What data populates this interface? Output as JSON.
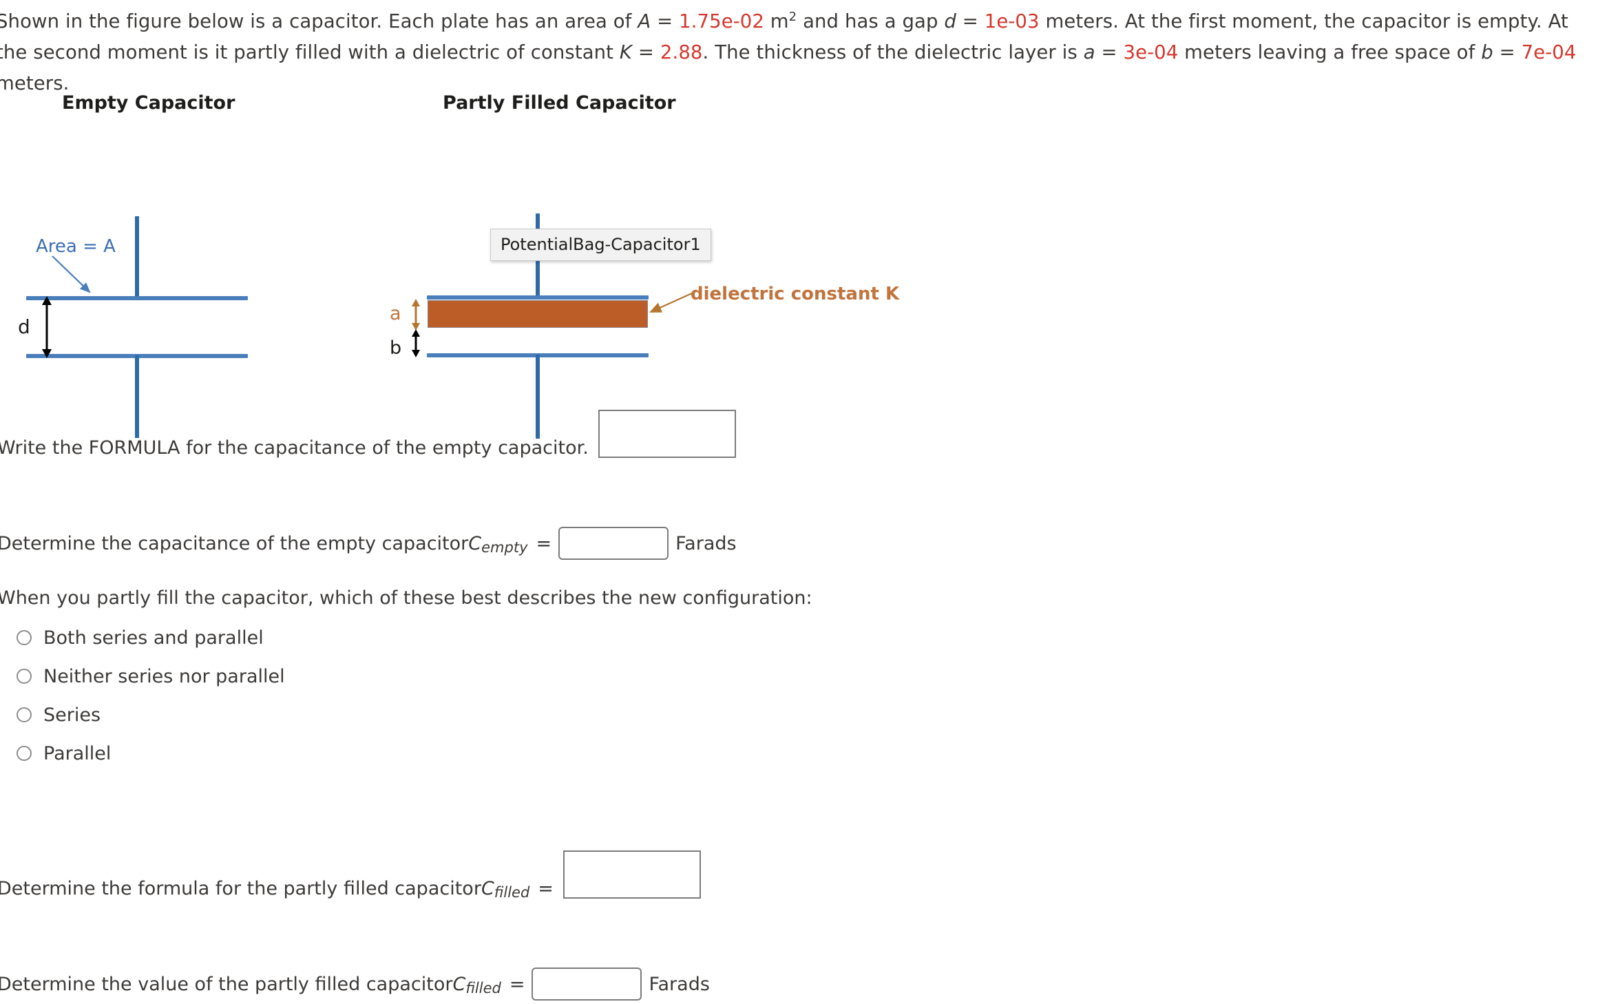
{
  "intro": {
    "seg1": "Shown in the figure below is a capacitor. Each plate has an area of ",
    "symbol_A": "A",
    "eq1": " = ",
    "area_value": "1.75e-02",
    "unit_m": " m",
    "sup2": "2",
    "seg2": " and has a gap ",
    "symbol_d": "d",
    "eq2": " = ",
    "gap_value": "1e-03",
    "seg3": " meters. At the first moment, the capacitor is empty. At the second moment is it partly filled with a dielectric of constant ",
    "symbol_K": "K",
    "eq3": " = ",
    "k_value": "2.88",
    "seg4": ". The thickness of the dielectric layer is ",
    "symbol_a": "a",
    "eq4": " = ",
    "a_value": "3e-04",
    "seg5": " meters leaving a free space of ",
    "symbol_b": "b",
    "eq5": " = ",
    "b_value": "7e-04",
    "seg6": " meters."
  },
  "figure": {
    "empty_title": "Empty Capacitor",
    "filled_title": "Partly Filled Capacitor",
    "area_label": "Area = A",
    "d_label": "d",
    "a_label": "a",
    "b_label": "b",
    "tooltip": "PotentialBag-Capacitor1",
    "dielectric_label": "dielectric constant K"
  },
  "questions": {
    "q1": {
      "text": "Write the FORMULA for the capacitance of the empty capacitor.",
      "value": ""
    },
    "q2": {
      "text": "Determine the capacitance of the empty capacitor ",
      "symbol": "C",
      "subscript": "empty",
      "equals": "=",
      "value": "",
      "unit": "Farads"
    },
    "q3": {
      "text": "When you partly fill the capacitor, which of these best describes the new configuration:"
    },
    "q4": {
      "text": "Determine the formula for the partly filled capacitor ",
      "symbol": "C",
      "subscript": "filled",
      "equals": "=",
      "value": ""
    },
    "q5": {
      "text": "Determine the value of the partly filled capacitor ",
      "symbol": "C",
      "subscript": "filled",
      "equals": "=",
      "value": "",
      "unit": "Farads"
    }
  },
  "options": [
    {
      "label": "Both series and parallel",
      "selected": false
    },
    {
      "label": "Neither series nor parallel",
      "selected": false
    },
    {
      "label": "Series",
      "selected": false
    },
    {
      "label": "Parallel",
      "selected": false
    }
  ],
  "colors": {
    "value_red": "#d5362c",
    "plate_blue": "#4a7ebb",
    "lead_blue": "#2f6aa8",
    "dielectric_orange": "#bc5c26",
    "dielectric_text": "#c1733c",
    "area_text": "#3c6eb4",
    "box_border": "#7b7b7b"
  }
}
